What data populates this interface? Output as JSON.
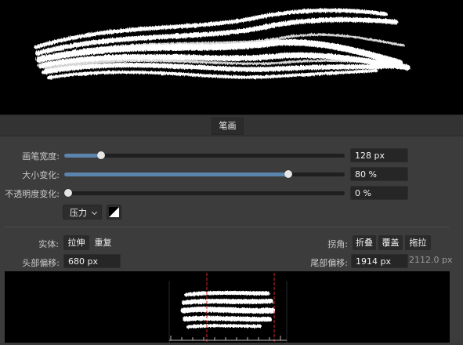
{
  "tabs": [
    {
      "label": "笔画"
    }
  ],
  "controls": {
    "width": {
      "label": "画笔宽度:",
      "value": "128 px",
      "level": 0.13
    },
    "size_variance": {
      "label": "大小变化:",
      "value": "80 %",
      "level": 0.8
    },
    "opacity_variance": {
      "label": "不透明度变化:",
      "value": "0 %",
      "level": 0.0
    },
    "controller": {
      "selected": "压力"
    }
  },
  "body": {
    "label": "实体:",
    "options": [
      "拉伸",
      "重复"
    ],
    "selected": "拉伸"
  },
  "corners": {
    "label": "拐角:",
    "options": [
      "折叠",
      "覆盖",
      "拖拉"
    ]
  },
  "head_offset": {
    "label": "头部偏移:",
    "value": "680 px"
  },
  "tail_offset": {
    "label": "尾部偏移:",
    "value": "1914 px"
  },
  "total_length": "2112.0 px",
  "colors": {
    "accent": "#5c85ad",
    "marker": "#d9262b",
    "field_bg": "#262626"
  }
}
